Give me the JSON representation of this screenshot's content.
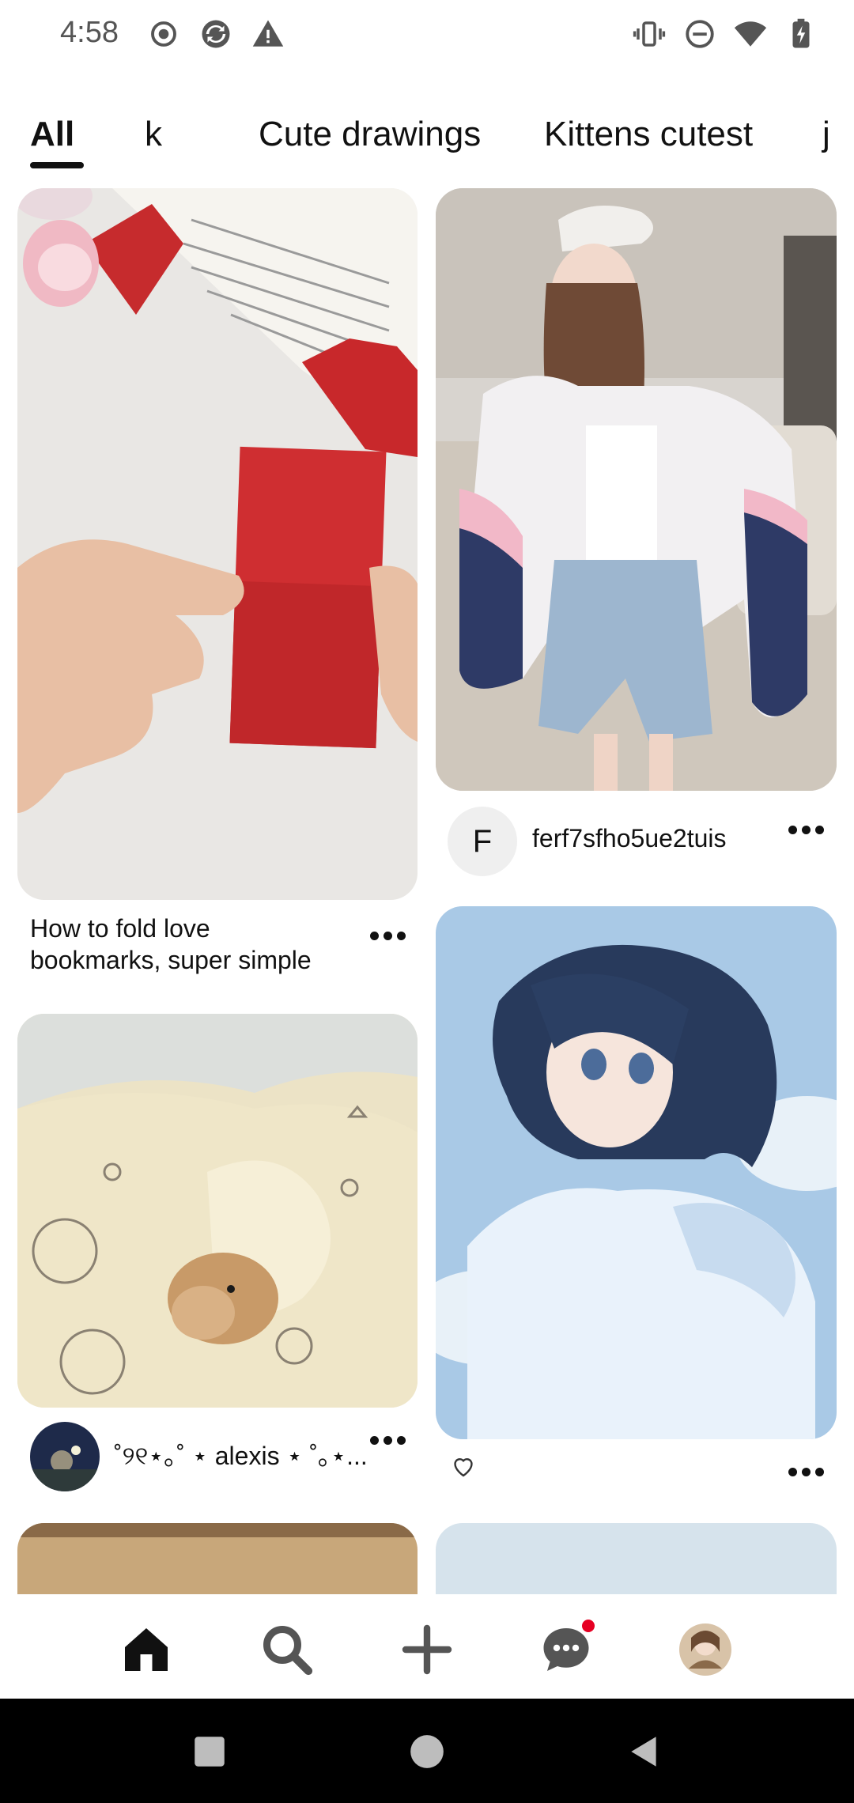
{
  "status_bar": {
    "time": "4:58",
    "icons_left": [
      "record-icon",
      "sync-icon",
      "warning-icon"
    ],
    "icons_right": [
      "vibrate-icon",
      "do-not-disturb-icon",
      "wifi-icon",
      "battery-icon"
    ]
  },
  "tabs": [
    {
      "label": "All",
      "selected": true
    },
    {
      "label": "k",
      "selected": false
    },
    {
      "label": "Cute drawings",
      "selected": false
    },
    {
      "label": "Kittens cutest",
      "selected": false
    },
    {
      "label": "j",
      "selected": false
    }
  ],
  "pins": [
    {
      "image": "origami-heart-bookmark-photo",
      "title_line1": "How to fold love",
      "title_line2": "bookmarks, super simple"
    },
    {
      "image": "fashion-jacket-photo",
      "author_initial": "F",
      "author": "ferf7sfho5ue2tuis"
    },
    {
      "image": "hamster-blanket-photo",
      "author": "˚୨୧⋆｡˚ ⋆ alexis ⋆ ˚｡⋆..."
    },
    {
      "image": "anime-girl-hoodie-illustration",
      "like_icon": "heart-outline-icon"
    }
  ],
  "bottom_nav": {
    "items": [
      "home-icon",
      "search-icon",
      "create-plus-icon",
      "messages-icon",
      "profile-avatar"
    ],
    "notification_color": "#e60023"
  },
  "system_nav": [
    "recents-square",
    "home-circle",
    "back-triangle"
  ]
}
